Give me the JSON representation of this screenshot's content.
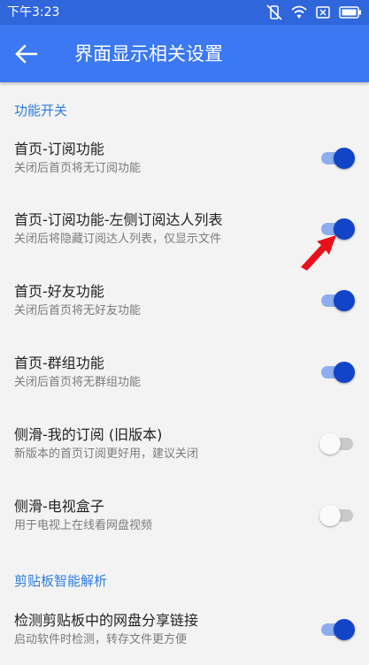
{
  "status_bar": {
    "time": "下午3:23",
    "icons": [
      "vibrate-icon",
      "wifi-icon",
      "sim-icon",
      "battery-icon"
    ]
  },
  "app_bar": {
    "back_icon": "back-arrow-icon",
    "title": "界面显示相关设置"
  },
  "sections": [
    {
      "header": "功能开关"
    },
    {
      "header": "剪贴板智能解析"
    }
  ],
  "settings": [
    {
      "title": "首页-订阅功能",
      "subtitle": "关闭后首页将无订阅功能",
      "enabled": true
    },
    {
      "title": "首页-订阅功能-左侧订阅达人列表",
      "subtitle": "关闭后将隐藏订阅达人列表，仅显示文件",
      "enabled": true
    },
    {
      "title": "首页-好友功能",
      "subtitle": "关闭后首页将无好友功能",
      "enabled": true
    },
    {
      "title": "首页-群组功能",
      "subtitle": "关闭后首页将无群组功能",
      "enabled": true
    },
    {
      "title": "侧滑-我的订阅 (旧版本)",
      "subtitle": "新版本的首页订阅更好用，建议关闭",
      "enabled": false
    },
    {
      "title": "侧滑-电视盒子",
      "subtitle": "用于电视上在线看网盘视频",
      "enabled": false
    },
    {
      "title": "检测剪贴板中的网盘分享链接",
      "subtitle": "启动软件时检测，转存文件更方便",
      "enabled": true
    }
  ],
  "colors": {
    "status_bar": "#2f66dc",
    "app_bar": "#3b78f2",
    "section_header": "#2f7de1",
    "toggle_on": "#1244c8",
    "annotation_arrow": "#e8101a"
  }
}
